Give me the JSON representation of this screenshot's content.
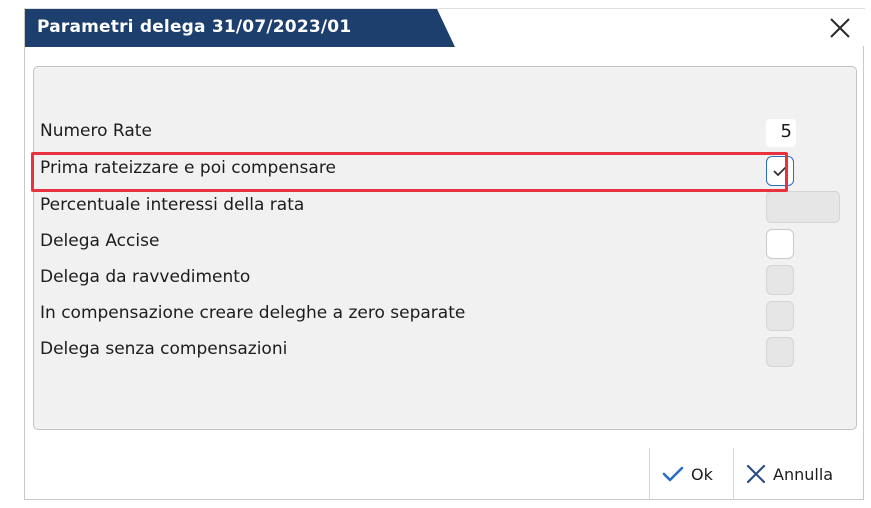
{
  "dialog": {
    "title": "Parametri delega 31/07/2023/01",
    "close_icon": "close-icon",
    "accent_color": "#1d3f6e"
  },
  "fields": {
    "numero_rate": {
      "label": "Numero Rate",
      "value": "5"
    },
    "prima_rateizzare": {
      "label": "Prima rateizzare e poi compensare",
      "checked": true
    },
    "percentuale_interessi": {
      "label": "Percentuale interessi della rata",
      "value": ""
    },
    "delega_accise": {
      "label": "Delega Accise",
      "checked": false
    },
    "delega_ravvedimento": {
      "label": "Delega da ravvedimento",
      "checked": false
    },
    "compensazione_zero": {
      "label": "In compensazione creare deleghe a zero separate",
      "checked": false
    },
    "senza_compensazioni": {
      "label": "Delega senza compensazioni",
      "checked": false
    }
  },
  "footer": {
    "ok_label": "Ok",
    "cancel_label": "Annulla",
    "ok_icon": "checkmark-icon",
    "cancel_icon": "x-icon"
  },
  "highlight_color": "#e8333f"
}
